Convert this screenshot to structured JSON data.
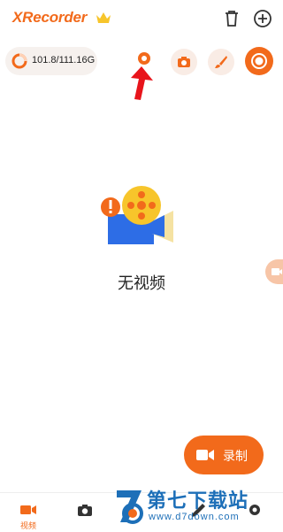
{
  "header": {
    "app_title": "XRecorder",
    "crown_icon": "crown-icon",
    "delete_icon": "trash-icon",
    "add_icon": "plus-circle-icon"
  },
  "toolbar": {
    "storage_text": "101.8/111.16G",
    "buttons": [
      "camera-icon",
      "screenshot-icon",
      "brush-icon",
      "record-icon"
    ]
  },
  "empty_state": {
    "message": "无视频"
  },
  "record_button": {
    "label": "录制",
    "icon": "video-camera-icon"
  },
  "bottom_nav": {
    "items": [
      {
        "label": "视频",
        "icon": "video-icon",
        "active": true
      },
      {
        "label": "",
        "icon": "camera-icon",
        "active": false
      },
      {
        "label": "",
        "icon": "pencil-icon",
        "active": false
      },
      {
        "label": "",
        "icon": "gear-icon",
        "active": false
      }
    ]
  },
  "watermark": {
    "text": "第七下载站",
    "url": "www.d7down.com"
  },
  "colors": {
    "accent": "#f26a1b",
    "accent_light": "#f9ece5",
    "watermark": "#1d6fb8"
  }
}
